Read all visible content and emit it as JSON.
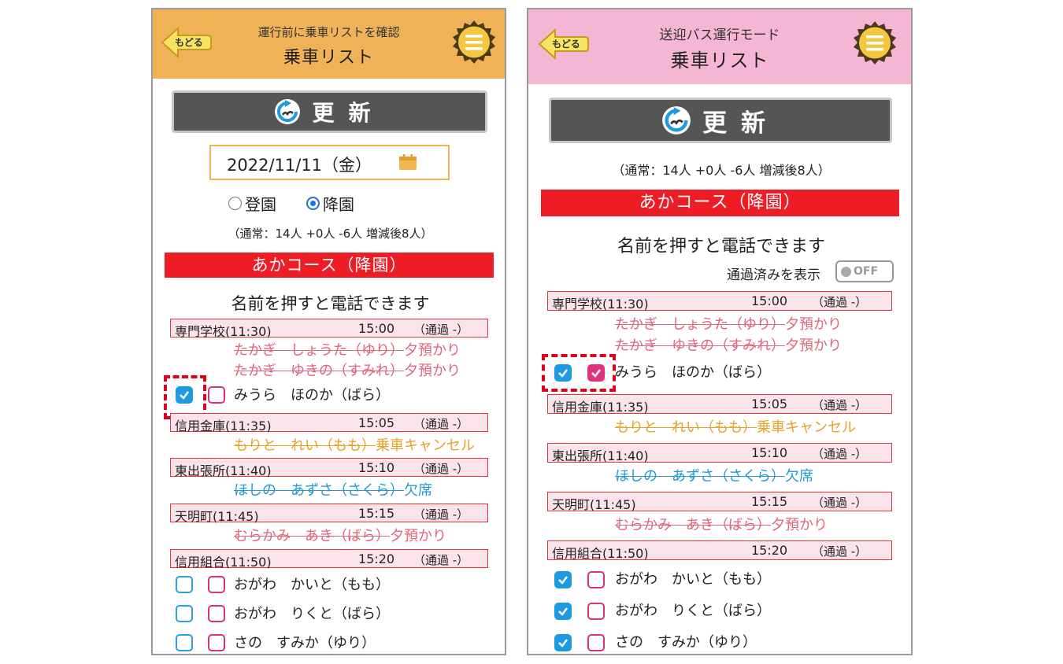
{
  "left": {
    "header": {
      "subtitle": "運行前に乗車リストを確認",
      "title": "乗車リスト",
      "back_label": "もどる",
      "color": "#efb257"
    },
    "update_label": "更新",
    "date": "2022/11/11（金）",
    "radio": {
      "option1": "登園",
      "option2": "降園",
      "selected": "降園"
    },
    "summary": "（通常：14人 +0人 -6人 増減後8人）",
    "course": "あかコース（降園）",
    "call_hint": "名前を押すと電話できます",
    "stops": [
      {
        "name": "専門学校(11:30)",
        "time": "15:00",
        "status": "（通過 -）"
      },
      {
        "name": "信用金庫(11:35)",
        "time": "15:05",
        "status": "（通過 -）"
      },
      {
        "name": "東出張所(11:40)",
        "time": "15:10",
        "status": "（通過 -）"
      },
      {
        "name": "天明町(11:45)",
        "time": "15:15",
        "status": "（通過 -）"
      },
      {
        "name": "信用組合(11:50)",
        "time": "15:20",
        "status": "（通過 -）"
      }
    ],
    "passengers": [
      {
        "name": "たかぎ　しょうた（ゆり）",
        "note": "夕預かり"
      },
      {
        "name": "たかぎ　ゆきの（すみれ）",
        "note": "夕預かり"
      },
      {
        "name": "みうら　ほのか（ばら）",
        "note": ""
      },
      {
        "name": "もりと　れい（もも）",
        "note": "乗車キャンセル"
      },
      {
        "name": "ほしの　あずさ（さくら）",
        "note": "欠席"
      },
      {
        "name": "むらかみ　あき（ばら）",
        "note": "夕預かり"
      },
      {
        "name": "おがわ　かいと（もも）",
        "note": ""
      },
      {
        "name": "おがわ　りくと（ばら）",
        "note": ""
      },
      {
        "name": "さの　すみか（ゆり）",
        "note": ""
      }
    ]
  },
  "right": {
    "header": {
      "subtitle": "送迎バス運行モード",
      "title": "乗車リスト",
      "back_label": "もどる",
      "color": "#f5b6d4"
    },
    "update_label": "更新",
    "summary": "（通常：14人 +0人 -6人 増減後8人）",
    "course": "あかコース（降園）",
    "call_hint": "名前を押すと電話できます",
    "toggle": {
      "label": "通過済みを表示",
      "state": "OFF"
    },
    "stops": [
      {
        "name": "専門学校(11:30)",
        "time": "15:00",
        "status": "（通過 -）"
      },
      {
        "name": "信用金庫(11:35)",
        "time": "15:05",
        "status": "（通過 -）"
      },
      {
        "name": "東出張所(11:40)",
        "time": "15:10",
        "status": "（通過 -）"
      },
      {
        "name": "天明町(11:45)",
        "time": "15:15",
        "status": "（通過 -）"
      },
      {
        "name": "信用組合(11:50)",
        "time": "15:20",
        "status": "（通過 -）"
      }
    ],
    "passengers": [
      {
        "name": "たかぎ　しょうた（ゆり）",
        "note": "夕預かり"
      },
      {
        "name": "たかぎ　ゆきの（すみれ）",
        "note": "夕預かり"
      },
      {
        "name": "みうら　ほのか（ばら）",
        "note": ""
      },
      {
        "name": "もりと　れい（もも）",
        "note": "乗車キャンセル"
      },
      {
        "name": "ほしの　あずさ（さくら）",
        "note": "欠席"
      },
      {
        "name": "むらかみ　あき（ばら）",
        "note": "夕預かり"
      },
      {
        "name": "おがわ　かいと（もも）",
        "note": ""
      },
      {
        "name": "おがわ　りくと（ばら）",
        "note": ""
      },
      {
        "name": "さの　すみか（ゆり）",
        "note": ""
      }
    ]
  },
  "colors": {
    "course_red": "#ee1c25",
    "check_blue": "#1e9be0",
    "check_pink": "#e0327e",
    "cancel_orange": "#e5a227",
    "absent_blue": "#2498d1",
    "pickup_pink": "#e16477"
  }
}
